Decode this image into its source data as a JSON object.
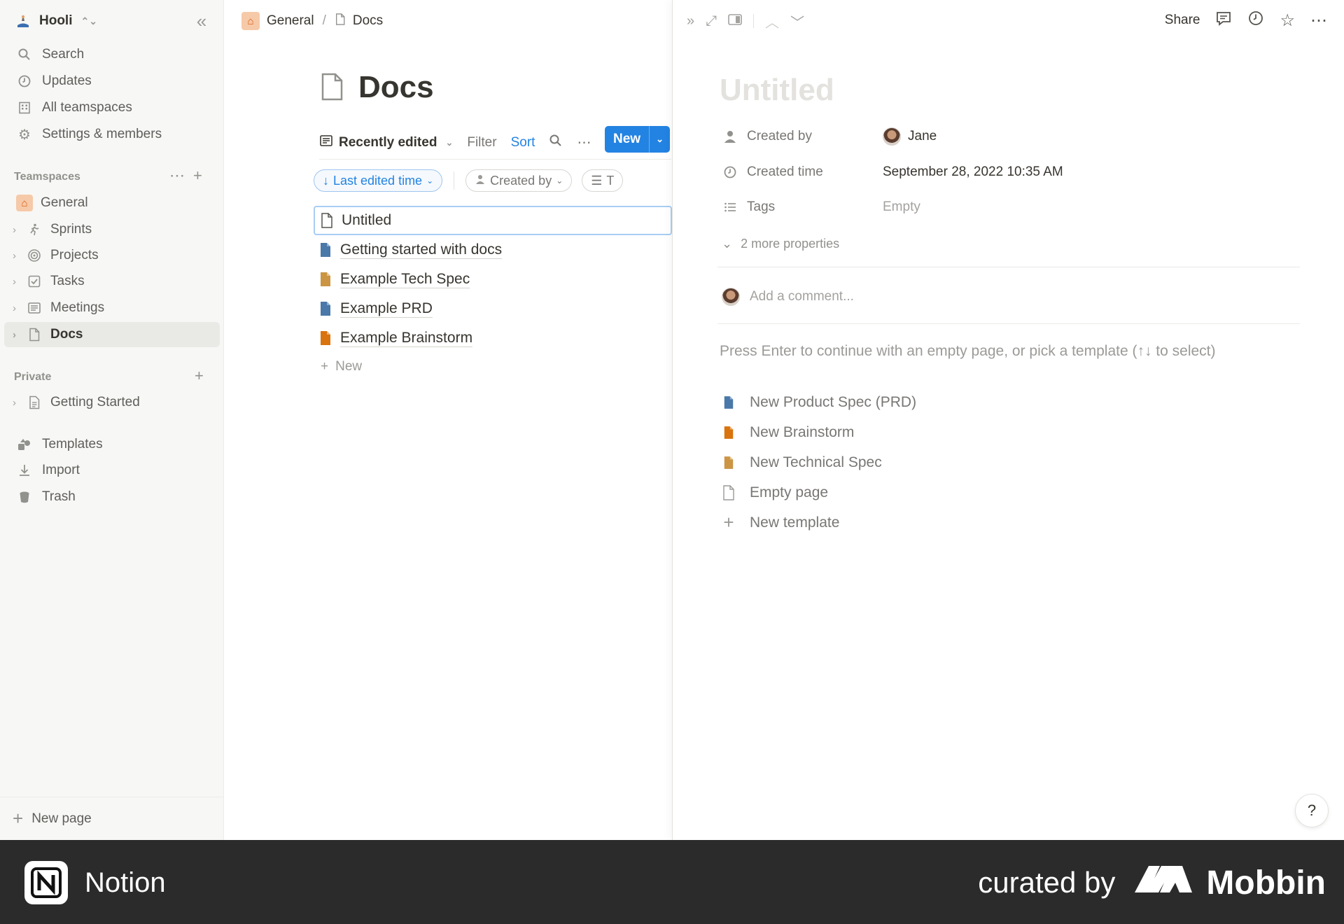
{
  "sidebar": {
    "workspace_name": "Hooli",
    "nav": [
      {
        "label": "Search",
        "icon": "search-icon"
      },
      {
        "label": "Updates",
        "icon": "clock-icon"
      },
      {
        "label": "All teamspaces",
        "icon": "building-icon"
      },
      {
        "label": "Settings & members",
        "icon": "gear-icon"
      }
    ],
    "teamspaces_label": "Teamspaces",
    "teamspace_items": [
      {
        "label": "General",
        "icon": "home-icon"
      },
      {
        "label": "Sprints",
        "icon": "runner-icon"
      },
      {
        "label": "Projects",
        "icon": "target-icon"
      },
      {
        "label": "Tasks",
        "icon": "checkbox-icon"
      },
      {
        "label": "Meetings",
        "icon": "notes-icon"
      },
      {
        "label": "Docs",
        "icon": "page-icon"
      }
    ],
    "private_label": "Private",
    "private_items": [
      {
        "label": "Getting Started",
        "icon": "page-text-icon"
      }
    ],
    "bottom_items": [
      {
        "label": "Templates",
        "icon": "templates-icon"
      },
      {
        "label": "Import",
        "icon": "download-icon"
      },
      {
        "label": "Trash",
        "icon": "trash-icon"
      }
    ],
    "new_page_label": "New page"
  },
  "breadcrumb": {
    "items": [
      "General",
      "Docs"
    ],
    "separator": "/"
  },
  "database": {
    "title": "Docs",
    "view_label": "Recently edited",
    "filter_label": "Filter",
    "sort_label": "Sort",
    "new_button_label": "New",
    "chips": {
      "sort_chip": "Last edited time",
      "created_by_chip": "Created by",
      "tags_chip_partial": "T"
    },
    "rows": [
      {
        "title": "Untitled",
        "icon": "blank-page-icon",
        "color": "#37352f"
      },
      {
        "title": "Getting started with docs",
        "icon": "doc-icon",
        "color": "#4a78a8"
      },
      {
        "title": "Example Tech Spec",
        "icon": "doc-icon",
        "color": "#cb9544"
      },
      {
        "title": "Example PRD",
        "icon": "doc-icon",
        "color": "#4a78a8"
      },
      {
        "title": "Example Brainstorm",
        "icon": "doc-icon",
        "color": "#d9730d"
      }
    ],
    "add_new_label": "New"
  },
  "peek": {
    "share_label": "Share",
    "title_placeholder": "Untitled",
    "properties": {
      "created_by": {
        "name": "Created by",
        "value": "Jane"
      },
      "created_time": {
        "name": "Created time",
        "value": "September 28, 2022 10:35 AM"
      },
      "tags": {
        "name": "Tags",
        "value": "Empty"
      }
    },
    "more_properties_label": "2 more properties",
    "comment_placeholder": "Add a comment...",
    "hint": "Press Enter to continue with an empty page, or pick a template (↑↓ to select)",
    "templates": [
      {
        "label": "New Product Spec (PRD)",
        "color": "#4a78a8"
      },
      {
        "label": "New Brainstorm",
        "color": "#d9730d"
      },
      {
        "label": "New Technical Spec",
        "color": "#cb9544"
      },
      {
        "label": "Empty page",
        "color": "#9b9a97"
      },
      {
        "label": "New template",
        "color": "#9b9a97"
      }
    ],
    "help_label": "?"
  },
  "brand_bar": {
    "app_name": "Notion",
    "curated_by": "curated by",
    "curator": "Mobbin"
  },
  "colors": {
    "accent": "#2383e2",
    "sidebar_bg": "#f7f7f5",
    "brand_bar_bg": "#2b2b2b"
  }
}
